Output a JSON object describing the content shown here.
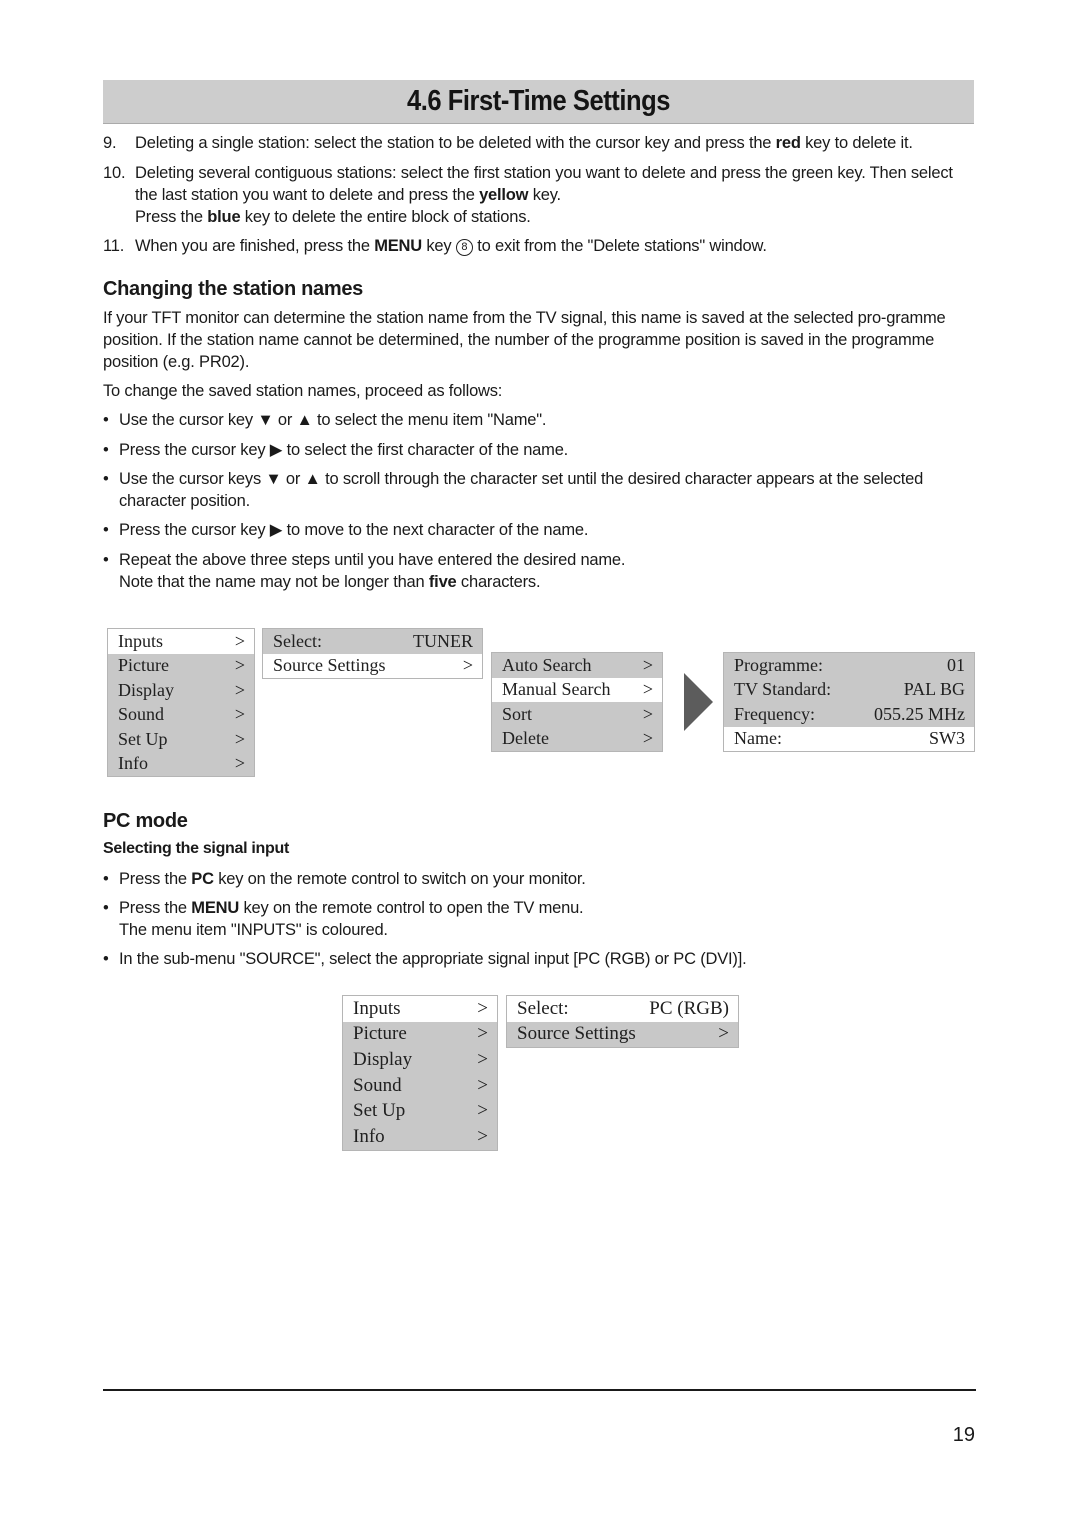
{
  "page": {
    "title": "4.6 First-Time Settings",
    "page_number": "19"
  },
  "numbered_items": [
    {
      "number": "9.",
      "parts": [
        {
          "text": "Deleting a single station: select the station to be deleted with the cursor key and press the "
        },
        {
          "text": "red",
          "bold": true
        },
        {
          "text": " key to delete it."
        }
      ]
    },
    {
      "number": "10.",
      "parts": [
        {
          "text": "Deleting several contiguous stations: select the first station you want to delete and press the green key. Then select the last station you want to delete and press the "
        },
        {
          "text": "yellow",
          "bold": true
        },
        {
          "text": " key."
        },
        {
          "br": true
        },
        {
          "text": "Press the "
        },
        {
          "text": "blue",
          "bold": true
        },
        {
          "text": " key to delete the entire block of stations."
        }
      ]
    },
    {
      "number": "11.",
      "parts": [
        {
          "text": "When you are finished, press the "
        },
        {
          "text": "MENU",
          "bold": true
        },
        {
          "text": " key "
        },
        {
          "circled": "8"
        },
        {
          "text": " to exit from the \"Delete stations\" window."
        }
      ]
    }
  ],
  "section_station_names": {
    "heading": "Changing the station names",
    "intro": "If your TFT monitor can determine the station name from the TV signal, this name is saved at the selected pro-gramme position. If the station name cannot be determined, the number of the programme position is saved in the programme position (e.g. PR02).",
    "lead": "To change the saved station names, proceed as follows:",
    "bullets": [
      [
        {
          "text": "Use the cursor key ▼ or ▲ to select the menu item \"Name\"."
        }
      ],
      [
        {
          "text": "Press the cursor key ▶ to select the first character of the name."
        }
      ],
      [
        {
          "text": "Use the cursor keys ▼ or ▲ to scroll through the character set until the desired character appears at the selected character position."
        }
      ],
      [
        {
          "text": "Press the cursor key ▶ to move to the next character of the name."
        }
      ],
      [
        {
          "text": "Repeat the above three steps until you have entered the desired name."
        },
        {
          "br": true
        },
        {
          "text": "Note that the name may not be longer than "
        },
        {
          "text": "five",
          "bold": true
        },
        {
          "text": " characters."
        }
      ]
    ]
  },
  "diagram_tuner": {
    "main_menu": [
      {
        "label": "Inputs",
        "arrow": ">",
        "selected": true
      },
      {
        "label": "Picture",
        "arrow": ">",
        "selected": false
      },
      {
        "label": "Display",
        "arrow": ">",
        "selected": false
      },
      {
        "label": "Sound",
        "arrow": ">",
        "selected": false
      },
      {
        "label": "Set Up",
        "arrow": ">",
        "selected": false
      },
      {
        "label": "Info",
        "arrow": ">",
        "selected": false
      }
    ],
    "inputs_menu": [
      {
        "label": "Select:",
        "value": "TUNER",
        "selected": false
      },
      {
        "label": "Source Settings",
        "value": ">",
        "selected": true
      }
    ],
    "source_settings_menu": [
      {
        "label": "Auto Search",
        "arrow": ">",
        "selected": false
      },
      {
        "label": "Manual Search",
        "arrow": ">",
        "selected": true
      },
      {
        "label": "Sort",
        "arrow": ">",
        "selected": false
      },
      {
        "label": "Delete",
        "arrow": ">",
        "selected": false
      }
    ],
    "manual_search_panel": [
      {
        "label": "Programme:",
        "value": "01",
        "selected": false
      },
      {
        "label": "TV Standard:",
        "value": "PAL BG",
        "selected": false
      },
      {
        "label": "Frequency:",
        "value": "055.25 MHz",
        "selected": false
      },
      {
        "label": "Name:",
        "value": "SW3",
        "selected": true
      }
    ]
  },
  "section_pc_mode": {
    "heading": "PC mode",
    "subheading": "Selecting the signal input",
    "bullets": [
      [
        {
          "text": "Press the "
        },
        {
          "text": "PC",
          "bold": true
        },
        {
          "text": " key on the remote control to switch on your monitor."
        }
      ],
      [
        {
          "text": "Press the "
        },
        {
          "text": "MENU",
          "bold": true
        },
        {
          "text": " key on the remote control to open the TV menu."
        },
        {
          "br": true
        },
        {
          "text": "The menu item \"INPUTS\" is coloured."
        }
      ],
      [
        {
          "text": "In the sub-menu \"SOURCE\", select the appropriate signal input [PC (RGB) or PC (DVI)]."
        }
      ]
    ]
  },
  "diagram_pc": {
    "main_menu": [
      {
        "label": "Inputs",
        "arrow": ">",
        "selected": true
      },
      {
        "label": "Picture",
        "arrow": ">",
        "selected": false
      },
      {
        "label": "Display",
        "arrow": ">",
        "selected": false
      },
      {
        "label": "Sound",
        "arrow": ">",
        "selected": false
      },
      {
        "label": "Set Up",
        "arrow": ">",
        "selected": false
      },
      {
        "label": "Info",
        "arrow": ">",
        "selected": false
      }
    ],
    "inputs_menu": [
      {
        "label": "Select:",
        "value": "PC (RGB)",
        "selected": true
      },
      {
        "label": "Source Settings",
        "value": ">",
        "selected": false
      }
    ]
  },
  "icons": {
    "arrow_right": "right-triangle-arrow",
    "bullet": "•"
  }
}
